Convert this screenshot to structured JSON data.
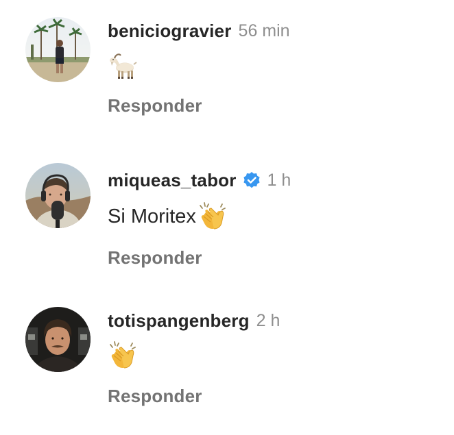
{
  "comments": [
    {
      "username": "beniciogravier",
      "time": "56 min",
      "verified": false,
      "text": "",
      "emoji": "goat-emoji",
      "reply_label": "Responder"
    },
    {
      "username": "miqueas_tabor",
      "time": "1 h",
      "verified": true,
      "text": "Si Moritex",
      "emoji": "clapping-hands-emoji",
      "reply_label": "Responder"
    },
    {
      "username": "totispangenberg",
      "time": "2 h",
      "verified": false,
      "text": "",
      "emoji": "clapping-hands-emoji",
      "reply_label": "Responder"
    }
  ],
  "colors": {
    "username": "#262626",
    "time": "#8e8e8e",
    "reply": "#737373",
    "verified_badge": "#3897f0"
  }
}
